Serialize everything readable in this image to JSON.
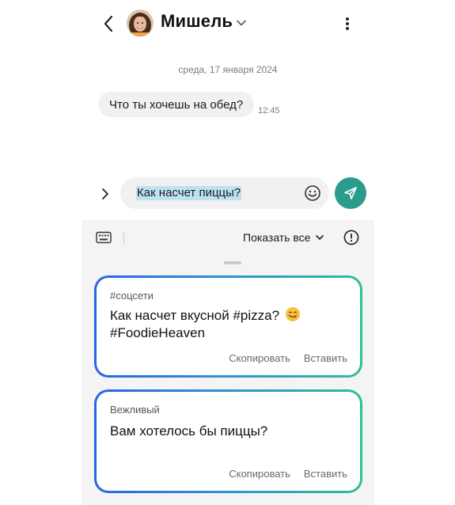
{
  "header": {
    "contact_name": "Мишель"
  },
  "conversation": {
    "date": "среда, 17 января 2024",
    "messages": [
      {
        "text": "Что ты хочешь на обед?",
        "time": "12:45",
        "direction": "incoming"
      }
    ]
  },
  "composer": {
    "text": "Как насчет пиццы?",
    "send_color": "#2a9c8b"
  },
  "suggestions": {
    "show_all_label": "Показать все",
    "cards": [
      {
        "tag": "#соцсети",
        "text_line1": "Как насчет вкусной #pizza?",
        "emoji": "yum-face-icon",
        "text_line2": "#FoodieHeaven",
        "copy_label": "Скопировать",
        "insert_label": "Вставить"
      },
      {
        "tag": "Вежливый",
        "text": "Вам хотелось бы пиццы?",
        "copy_label": "Скопировать",
        "insert_label": "Вставить"
      }
    ]
  },
  "colors": {
    "accent": "#2a9c8b",
    "gradient_start": "#2b63e4",
    "gradient_end": "#2dbe9a",
    "selection": "#bfe2f2"
  }
}
